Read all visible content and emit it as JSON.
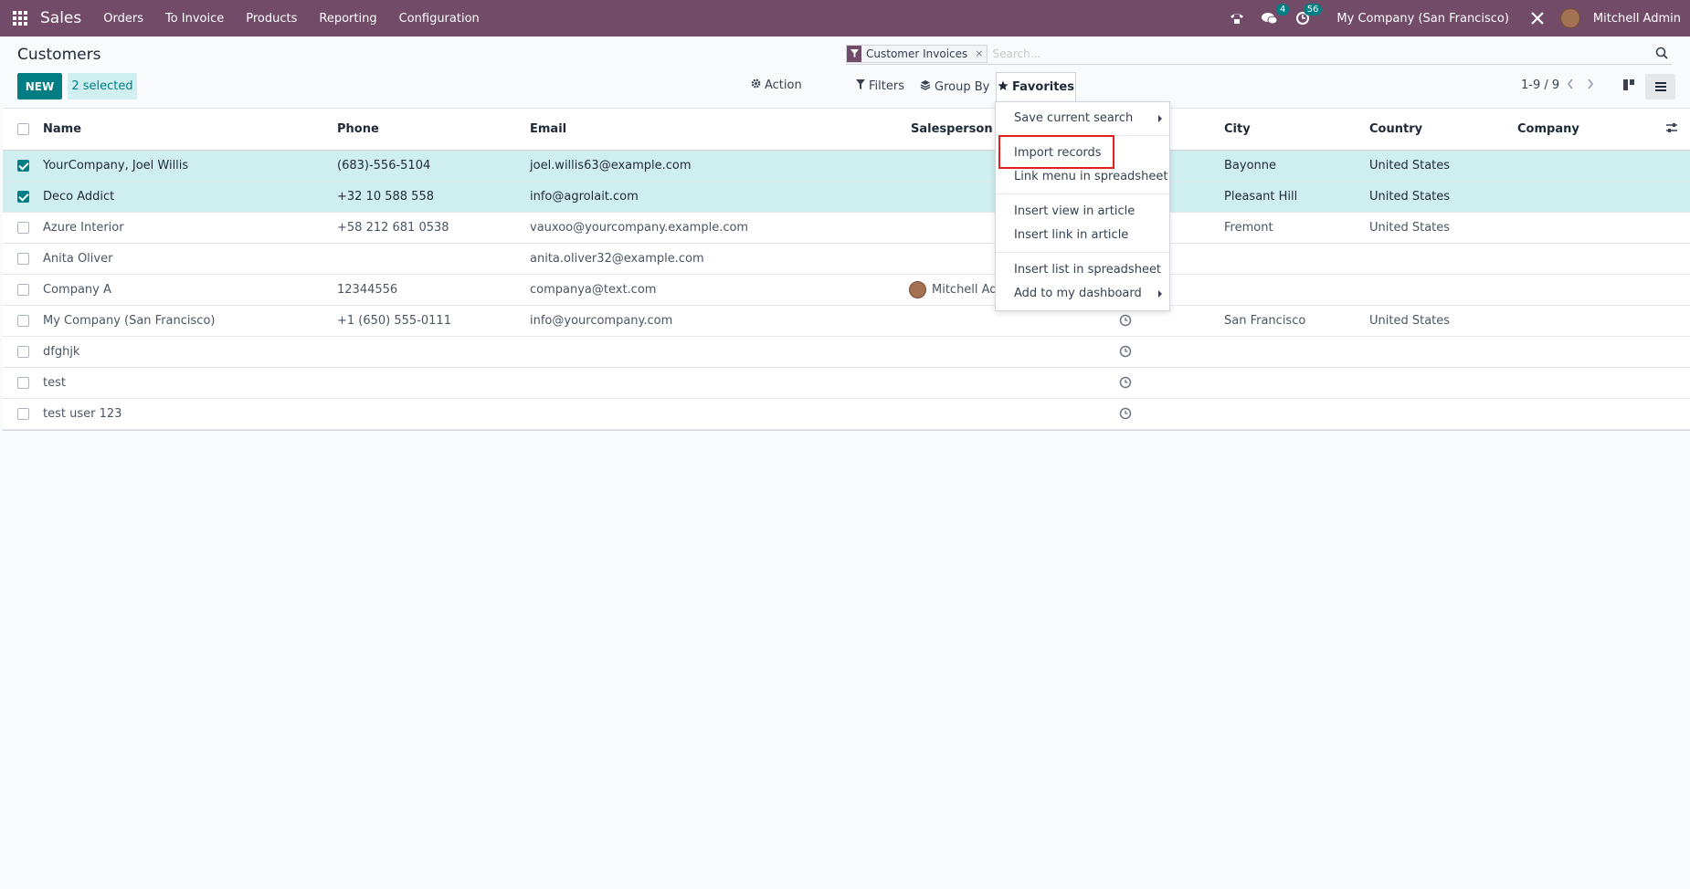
{
  "topbar": {
    "app_name": "Sales",
    "menu": [
      "Orders",
      "To Invoice",
      "Products",
      "Reporting",
      "Configuration"
    ],
    "messages_count": "4",
    "activities_count": "56",
    "company": "My Company (San Francisco)",
    "user": "Mitchell Admin",
    "color": "#714b67"
  },
  "control": {
    "title": "Customers",
    "new_label": "NEW",
    "selected_label": "2 selected",
    "action_label": "Action",
    "filters_label": "Filters",
    "groupby_label": "Group By",
    "favorites_label": "Favorites",
    "pager": "1-9 / 9",
    "accent": "#017e84"
  },
  "search": {
    "facet_label": "Customer Invoices",
    "facet_remove": "×",
    "placeholder": "Search..."
  },
  "table": {
    "columns": [
      "Name",
      "Phone",
      "Email",
      "Salesperson",
      "City",
      "Country",
      "Company"
    ],
    "rows": [
      {
        "selected": true,
        "name": "YourCompany, Joel Willis",
        "phone": "(683)-556-5104",
        "email": "joel.willis63@example.com",
        "salesperson": "",
        "activity": false,
        "city": "Bayonne",
        "country": "United States"
      },
      {
        "selected": true,
        "name": "Deco Addict",
        "phone": "+32 10 588 558",
        "email": "info@agrolait.com",
        "salesperson": "",
        "activity": false,
        "city": "Pleasant Hill",
        "country": "United States"
      },
      {
        "selected": false,
        "name": "Azure Interior",
        "phone": "+58 212 681 0538",
        "email": "vauxoo@yourcompany.example.com",
        "salesperson": "",
        "activity": false,
        "city": "Fremont",
        "country": "United States"
      },
      {
        "selected": false,
        "name": "Anita Oliver",
        "phone": "",
        "email": "anita.oliver32@example.com",
        "salesperson": "",
        "activity": false,
        "city": "",
        "country": ""
      },
      {
        "selected": false,
        "name": "Company A",
        "phone": "12344556",
        "email": "companya@text.com",
        "salesperson": "Mitchell Adr",
        "activity": false,
        "city": "",
        "country": ""
      },
      {
        "selected": false,
        "name": "My Company (San Francisco)",
        "phone": "+1 (650) 555-0111",
        "email": "info@yourcompany.com",
        "salesperson": "",
        "activity": true,
        "city": "San Francisco",
        "country": "United States"
      },
      {
        "selected": false,
        "name": "dfghjk",
        "phone": "",
        "email": "",
        "salesperson": "",
        "activity": true,
        "city": "",
        "country": ""
      },
      {
        "selected": false,
        "name": "test",
        "phone": "",
        "email": "",
        "salesperson": "",
        "activity": true,
        "city": "",
        "country": ""
      },
      {
        "selected": false,
        "name": "test user 123",
        "phone": "",
        "email": "",
        "salesperson": "",
        "activity": true,
        "city": "",
        "country": ""
      }
    ]
  },
  "favorites_menu": {
    "items": [
      {
        "label": "Save current search",
        "submenu": true
      },
      {
        "label": "Import records",
        "submenu": false
      },
      {
        "label": "Link menu in spreadsheet",
        "submenu": false
      },
      {
        "label": "Insert view in article",
        "submenu": false
      },
      {
        "label": "Insert link in article",
        "submenu": false
      },
      {
        "label": "Insert list in spreadsheet",
        "submenu": false
      },
      {
        "label": "Add to my dashboard",
        "submenu": true
      }
    ],
    "highlight_color": "#e0201f"
  }
}
